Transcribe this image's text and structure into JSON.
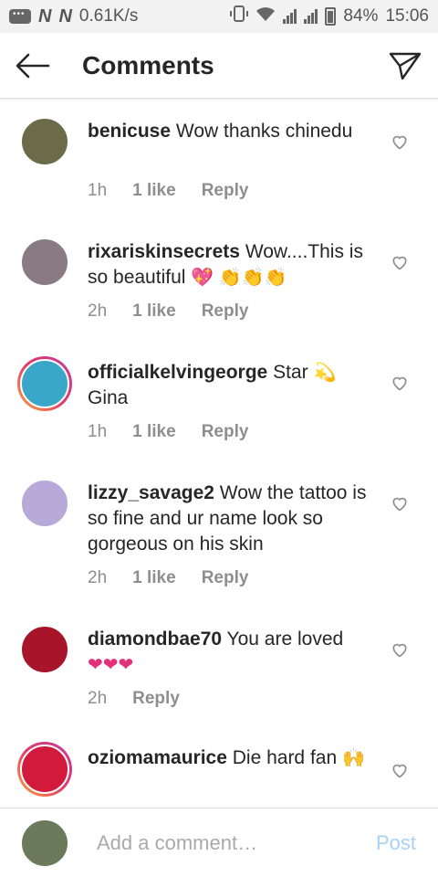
{
  "status_bar": {
    "carrier_marks": [
      "N",
      "N"
    ],
    "net_speed": "0.61K/s",
    "battery": "84%",
    "time": "15:06"
  },
  "header": {
    "title": "Comments",
    "back_icon": "arrow-left-icon",
    "share_icon": "paper-plane-icon"
  },
  "comments": [
    {
      "username": "benicuse",
      "text": "Wow thanks chinedu",
      "emoji": "",
      "time": "1h",
      "likes": "1 like",
      "reply": "Reply",
      "avatar_color": "#6b6b4a",
      "ring": false
    },
    {
      "username": "rixariskinsecrets",
      "text": "Wow....This is so beautiful",
      "emoji": "💖 👏👏👏",
      "time": "2h",
      "likes": "1 like",
      "reply": "Reply",
      "avatar_color": "#8a7a82",
      "ring": false
    },
    {
      "username": "officialkelvingeorge",
      "text": "Star",
      "emoji": "💫",
      "text2": "Gina",
      "time": "1h",
      "likes": "1 like",
      "reply": "Reply",
      "avatar_color": "#3aa6c8",
      "ring": true
    },
    {
      "username": "lizzy_savage2",
      "text": "Wow the tattoo is so fine and ur name look so gorgeous on his skin",
      "emoji": "",
      "time": "2h",
      "likes": "1 like",
      "reply": "Reply",
      "avatar_color": "#b7a9d8",
      "ring": false
    },
    {
      "username": "diamondbae70",
      "text": "You are loved",
      "emoji": "❤❤❤",
      "time": "2h",
      "likes": "",
      "reply": "Reply",
      "avatar_color": "#a8142a",
      "ring": false
    },
    {
      "username": "oziomamaurice",
      "text": "Die hard fan",
      "emoji": "🙌",
      "time": "",
      "likes": "",
      "reply": "",
      "avatar_color": "#d21a3c",
      "ring": true
    }
  ],
  "footer": {
    "placeholder": "Add a comment…",
    "post_label": "Post",
    "avatar_color": "#6a7a5a"
  }
}
